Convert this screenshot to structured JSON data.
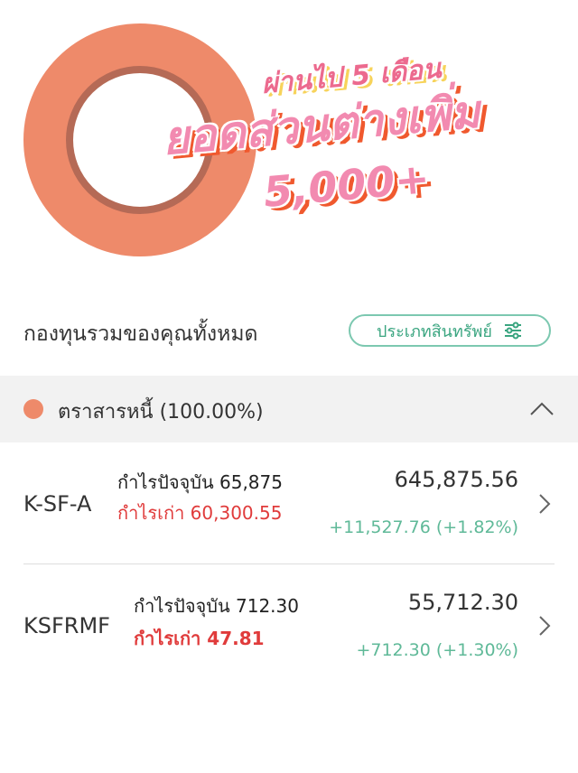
{
  "banner": {
    "line1": "ผ่านไป 5 เดือน",
    "line2": "ยอดส่วนต่างเพิ่ม",
    "line3": "5,000+",
    "colors": {
      "ring": "#ee8a6a",
      "ring_inner": "#b56a56",
      "text_pink": "#f28ab0",
      "text_shadow": "#f0592e"
    }
  },
  "portfolio": {
    "title": "กองทุนรวมของคุณทั้งหมด",
    "filter_label": "ประเภทสินทรัพย์",
    "filter_icon": "sliders-icon"
  },
  "group": {
    "label": "ตราสารหนี้ (100.00%)",
    "dot_color": "#ee8a6a",
    "toggle_icon": "chevron-up-icon"
  },
  "funds": [
    {
      "name": "K-SF-A",
      "profit": "กำไรปัจจุบัน 65,875",
      "old_profit": "กำไรเก่า 60,300.55",
      "value": "645,875.56",
      "change": "+11,527.76 (+1.82%)"
    },
    {
      "name": "KSFRMF",
      "profit": "กำไรปัจจุบัน 712.30",
      "old_profit": "กำไรเก่า 47.81",
      "value": "55,712.30",
      "change": "+712.30 (+1.30%)"
    }
  ],
  "colors": {
    "accent_green": "#3aa580",
    "loss_red": "#e03b3b",
    "gain_green": "#5fb998"
  }
}
